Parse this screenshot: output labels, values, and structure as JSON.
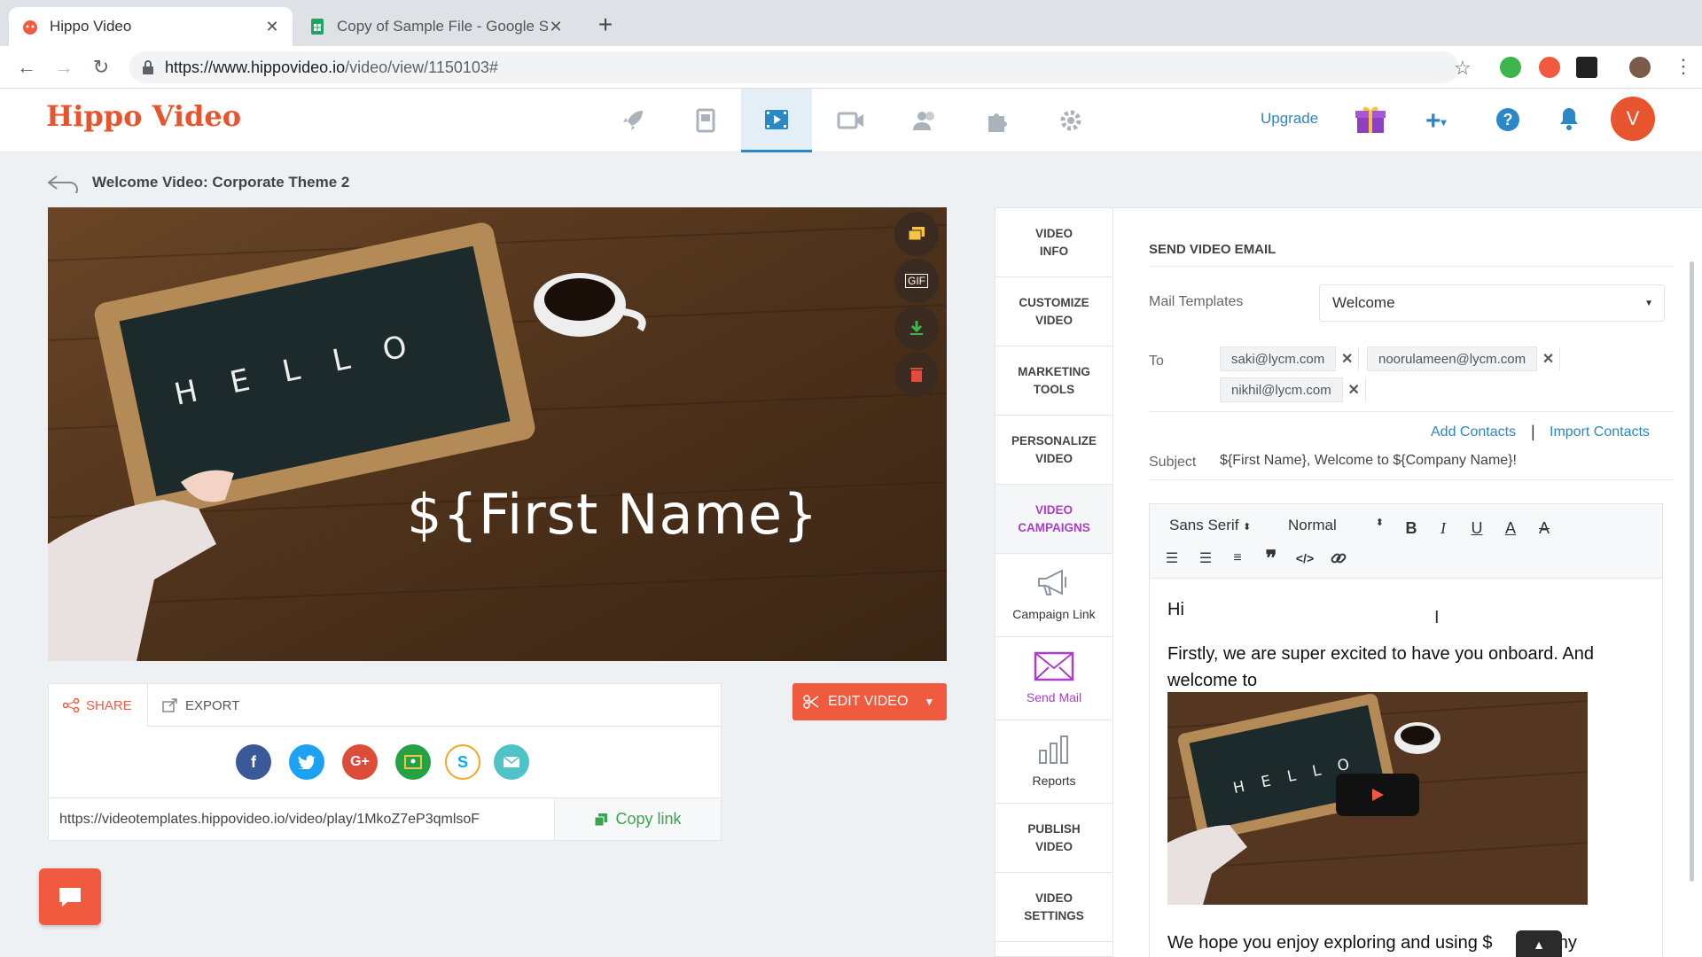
{
  "browser": {
    "tabs": [
      {
        "title": "Hippo Video",
        "active": true
      },
      {
        "title": "Copy of Sample File - Google S",
        "active": false
      }
    ],
    "url_domain": "https://www.hippovideo.io",
    "url_path": "/video/view/1150103#"
  },
  "app": {
    "logo": "Hippo Video",
    "upgrade_label": "Upgrade",
    "avatar_letter": "V",
    "nav_icons": [
      "rocket-icon",
      "library-icon",
      "video-icon",
      "camera-icon",
      "users-icon",
      "integrations-icon",
      "settings-icon"
    ],
    "accent": "#f05a3e",
    "link_color": "#2c87c7",
    "active_purple": "#a93ec8"
  },
  "page": {
    "breadcrumb_title": "Welcome Video: Corporate Theme 2",
    "video_overlay": {
      "chalkboard_text": "H E L L O",
      "name_placeholder": "${First Name}"
    },
    "video_tools": {
      "gif_label": "GIF"
    },
    "share": {
      "share_tab": "SHARE",
      "export_tab": "EXPORT",
      "social_icons": [
        "facebook-icon",
        "twitter-icon",
        "google-plus-icon",
        "classroom-icon",
        "skype-icon",
        "email-icon"
      ],
      "share_url": "https://videotemplates.hippovideo.io/video/play/1MkoZ7eP3qmlsoF",
      "copy_link_label": "Copy link"
    },
    "edit_video_label": "EDIT VIDEO"
  },
  "side_menu": [
    {
      "label1": "VIDEO",
      "label2": "INFO"
    },
    {
      "label1": "CUSTOMIZE",
      "label2": "VIDEO"
    },
    {
      "label1": "MARKETING",
      "label2": "TOOLS"
    },
    {
      "label1": "PERSONALIZE",
      "label2": "VIDEO"
    },
    {
      "label1": "VIDEO",
      "label2": "CAMPAIGNS"
    },
    {
      "label1": "Campaign Link"
    },
    {
      "label1": "Send Mail"
    },
    {
      "label1": "Reports"
    },
    {
      "label1": "PUBLISH",
      "label2": "VIDEO"
    },
    {
      "label1": "VIDEO",
      "label2": "SETTINGS"
    }
  ],
  "email_panel": {
    "title": "SEND VIDEO EMAIL",
    "mail_templates_label": "Mail Templates",
    "mail_template_value": "Welcome",
    "to_label": "To",
    "recipients": [
      "saki@lycm.com",
      "noorulameen@lycm.com",
      "nikhil@lycm.com"
    ],
    "add_contacts": "Add Contacts",
    "separator": "|",
    "import_contacts": "Import Contacts",
    "subject_label": "Subject",
    "subject_value": "${First Name}, Welcome to ${Company Name}!",
    "toolbar": {
      "font_family": "Sans Serif",
      "font_size": "Normal"
    },
    "body": {
      "greeting": "Hi",
      "line1": "Firstly, we are super excited to have you onboard. And",
      "line2": "welcome to",
      "footer_line": "We hope you enjoy exploring and using $",
      "footer_tail": "pany"
    }
  }
}
